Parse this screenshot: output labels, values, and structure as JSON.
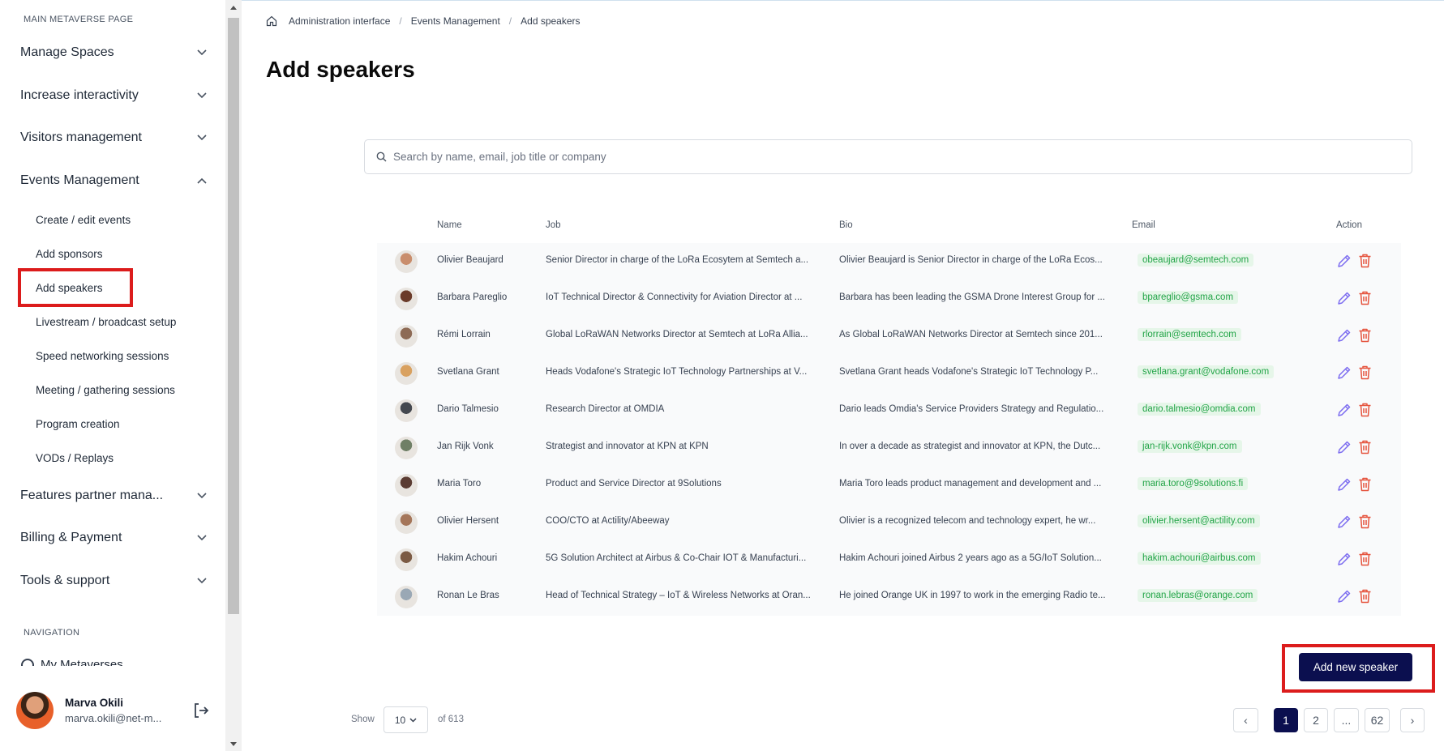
{
  "sidebar": {
    "section_title": "MAIN METAVERSE PAGE",
    "groups": [
      {
        "label": "Manage Spaces"
      },
      {
        "label": "Increase interactivity"
      },
      {
        "label": "Visitors management"
      },
      {
        "label": "Events Management"
      },
      {
        "label": "Features partner mana..."
      },
      {
        "label": "Billing & Payment"
      },
      {
        "label": "Tools & support"
      }
    ],
    "events_items": [
      {
        "label": "Create / edit events"
      },
      {
        "label": "Add sponsors"
      },
      {
        "label": "Add speakers"
      },
      {
        "label": "Livestream / broadcast setup"
      },
      {
        "label": "Speed networking sessions"
      },
      {
        "label": "Meeting / gathering sessions"
      },
      {
        "label": "Program creation"
      },
      {
        "label": "VODs / Replays"
      }
    ],
    "nav_title": "NAVIGATION",
    "nav_cutoff": "My Metaverses",
    "user": {
      "name": "Marva Okili",
      "email": "marva.okili@net-m..."
    }
  },
  "breadcrumb": [
    "Administration interface",
    "Events Management",
    "Add speakers"
  ],
  "page_title": "Add speakers",
  "search": {
    "placeholder": "Search by name, email, job title or company"
  },
  "table": {
    "headers": {
      "name": "Name",
      "job": "Job",
      "bio": "Bio",
      "email": "Email",
      "action": "Action"
    },
    "rows": [
      {
        "name": "Olivier Beaujard",
        "job": "Senior Director in charge of the LoRa Ecosytem at Semtech a...",
        "bio": "Olivier Beaujard is Senior Director in charge of the LoRa Ecos...",
        "email": "obeaujard@semtech.com"
      },
      {
        "name": "Barbara Pareglio",
        "job": "IoT Technical Director & Connectivity for Aviation Director at ...",
        "bio": "Barbara has been leading the GSMA Drone Interest Group for ...",
        "email": "bpareglio@gsma.com"
      },
      {
        "name": "Rémi Lorrain",
        "job": "Global LoRaWAN Networks Director at Semtech at LoRa Allia...",
        "bio": "As Global LoRaWAN Networks Director at Semtech since 201...",
        "email": "rlorrain@semtech.com"
      },
      {
        "name": "Svetlana Grant",
        "job": "Heads Vodafone's Strategic IoT Technology Partnerships at V...",
        "bio": "Svetlana Grant heads Vodafone's Strategic IoT Technology P...",
        "email": "svetlana.grant@vodafone.com"
      },
      {
        "name": "Dario Talmesio",
        "job": "Research Director at OMDIA",
        "bio": "Dario leads Omdia's Service Providers Strategy and Regulatio...",
        "email": "dario.talmesio@omdia.com"
      },
      {
        "name": "Jan Rijk Vonk",
        "job": "Strategist and innovator at KPN at KPN",
        "bio": "In over a decade as strategist and innovator at KPN, the Dutc...",
        "email": "jan-rijk.vonk@kpn.com"
      },
      {
        "name": "Maria Toro",
        "job": "Product and Service Director at 9Solutions",
        "bio": "Maria Toro leads product management and development and ...",
        "email": "maria.toro@9solutions.fi"
      },
      {
        "name": "Olivier Hersent",
        "job": "COO/CTO at Actility/Abeeway",
        "bio": "Olivier is a recognized telecom and technology expert, he wr...",
        "email": "olivier.hersent@actility.com"
      },
      {
        "name": "Hakim Achouri",
        "job": "5G Solution Architect at Airbus & Co-Chair IOT & Manufacturi...",
        "bio": "Hakim Achouri joined Airbus 2 years ago as a 5G/IoT Solution...",
        "email": "hakim.achouri@airbus.com"
      },
      {
        "name": "Ronan Le Bras",
        "job": "Head of Technical Strategy – IoT & Wireless Networks at Oran...",
        "bio": "He joined Orange UK in 1997 to work in the emerging Radio te...",
        "email": "ronan.lebras@orange.com"
      }
    ]
  },
  "add_button": "Add new speaker",
  "pagination": {
    "show_label": "Show",
    "page_size": "10",
    "total": "of 613",
    "prev": "‹",
    "next": "›",
    "pages": [
      "1",
      "2",
      "...",
      "62"
    ],
    "current": "1"
  },
  "colors": {
    "accent_dark": "#0b0f4f",
    "highlight_red": "#dc1c1c",
    "email_green": "#22a447",
    "edit_purple": "#7c6cf0",
    "delete_red": "#e5533d"
  },
  "icons": [
    "home-icon",
    "chevron-down-icon",
    "chevron-up-icon",
    "search-icon",
    "edit-pencil-icon",
    "trash-icon",
    "logout-icon"
  ]
}
